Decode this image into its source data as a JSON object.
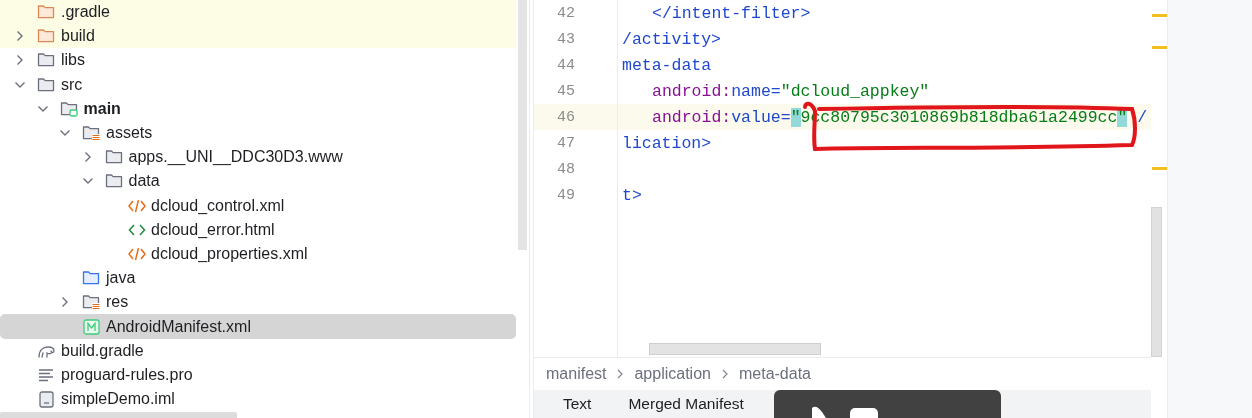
{
  "project_tree": [
    {
      "label": ".gradle",
      "kind": "folder-excluded",
      "selected": false,
      "highlighted": true
    },
    {
      "label": "build",
      "kind": "folder-excluded",
      "expanded": false,
      "selected": false,
      "highlighted": true
    },
    {
      "label": "libs",
      "kind": "folder",
      "expanded": false,
      "selected": false,
      "highlighted": false
    },
    {
      "label": "src",
      "kind": "folder",
      "expanded": true,
      "selected": false,
      "highlighted": false,
      "children": [
        {
          "label": "main",
          "kind": "module-folder",
          "expanded": true,
          "selected": false,
          "highlighted": false,
          "children": [
            {
              "label": "assets",
              "kind": "resource-folder",
              "expanded": true,
              "selected": false,
              "highlighted": false,
              "children": [
                {
                  "label": "apps.__UNI__DDC30D3.www",
                  "kind": "folder",
                  "expanded": false,
                  "selected": false,
                  "highlighted": false
                },
                {
                  "label": "data",
                  "kind": "folder",
                  "expanded": true,
                  "selected": false,
                  "highlighted": false,
                  "children": [
                    {
                      "label": "dcloud_control.xml",
                      "kind": "xml-file",
                      "selected": false,
                      "highlighted": false
                    },
                    {
                      "label": "dcloud_error.html",
                      "kind": "html-file",
                      "selected": false,
                      "highlighted": false
                    },
                    {
                      "label": "dcloud_properties.xml",
                      "kind": "xml-file",
                      "selected": false,
                      "highlighted": false
                    }
                  ]
                }
              ]
            },
            {
              "label": "java",
              "kind": "source-folder",
              "selected": false,
              "highlighted": false
            },
            {
              "label": "res",
              "kind": "resource-folder",
              "expanded": false,
              "selected": false,
              "highlighted": false
            },
            {
              "label": "AndroidManifest.xml",
              "kind": "manifest-file",
              "selected": true,
              "highlighted": false
            }
          ]
        }
      ]
    },
    {
      "label": "build.gradle",
      "kind": "gradle-file",
      "selected": false,
      "highlighted": false
    },
    {
      "label": "proguard-rules.pro",
      "kind": "text-file",
      "selected": false,
      "highlighted": false
    },
    {
      "label": "simpleDemo.iml",
      "kind": "module-file",
      "selected": false,
      "highlighted": false
    }
  ],
  "editor": {
    "lines": [
      {
        "number": "42",
        "current": false,
        "indented": true,
        "tokens": [
          {
            "text": "</intent-filter>",
            "kind": "tag"
          }
        ]
      },
      {
        "number": "43",
        "current": false,
        "indented": false,
        "tokens": [
          {
            "text": "/activity>",
            "kind": "tag"
          }
        ]
      },
      {
        "number": "44",
        "current": false,
        "indented": false,
        "tokens": [
          {
            "text": "meta-data",
            "kind": "tag"
          }
        ]
      },
      {
        "number": "45",
        "current": false,
        "indented": true,
        "tokens": [
          {
            "text": "android",
            "kind": "ns"
          },
          {
            "text": ":",
            "kind": "ns"
          },
          {
            "text": "name",
            "kind": "attr"
          },
          {
            "text": "=",
            "kind": "attr"
          },
          {
            "text": "\"dcloud_appkey\"",
            "kind": "string"
          }
        ]
      },
      {
        "number": "46",
        "current": true,
        "indented": true,
        "tokens": [
          {
            "text": "android",
            "kind": "ns"
          },
          {
            "text": ":",
            "kind": "ns"
          },
          {
            "text": "value",
            "kind": "attr"
          },
          {
            "text": "=",
            "kind": "attr"
          },
          {
            "text": "\"",
            "kind": "match"
          },
          {
            "text": "9cc80795c3010869b818dba61a2499cc",
            "kind": "string"
          },
          {
            "text": "\"",
            "kind": "match"
          },
          {
            "text": " /",
            "kind": "tag"
          }
        ]
      },
      {
        "number": "47",
        "current": false,
        "indented": false,
        "tokens": [
          {
            "text": "lication>",
            "kind": "tag"
          }
        ]
      },
      {
        "number": "48",
        "current": false
      },
      {
        "number": "49",
        "current": false,
        "indented": false,
        "tokens": [
          {
            "text": "t>",
            "kind": "tag"
          }
        ]
      }
    ],
    "breadcrumb": [
      "manifest",
      "application",
      "meta-data"
    ],
    "tabs": [
      "Text",
      "Merged Manifest"
    ]
  }
}
